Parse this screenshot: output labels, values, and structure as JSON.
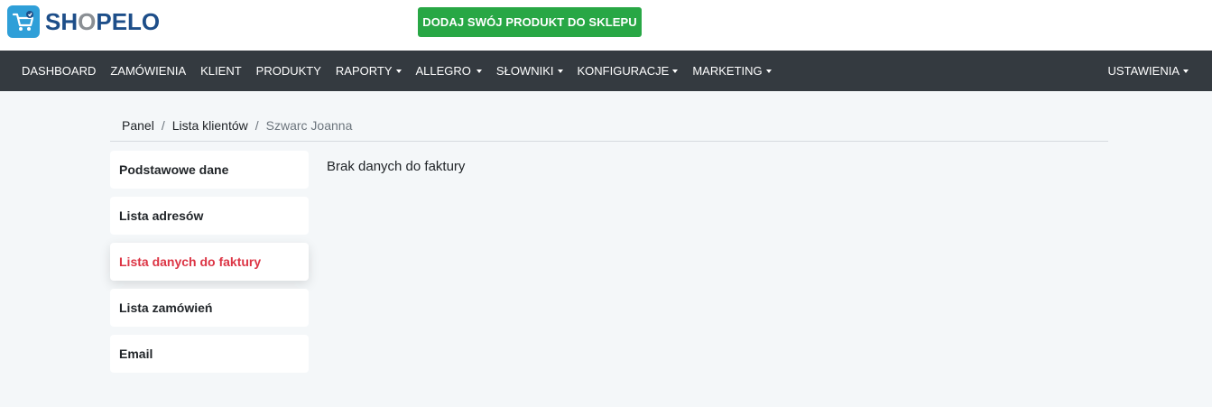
{
  "brand": {
    "logo_prefix": "SH",
    "logo_o": "O",
    "logo_suffix": "PELO",
    "primary_color": "#1d4e89",
    "accent_color": "#2f9fd8"
  },
  "header": {
    "cta_label": "DODAJ SWÓJ PRODUKT DO SKLEPU",
    "cta_color": "#28a745"
  },
  "nav": {
    "items": [
      {
        "label": "DASHBOARD",
        "dropdown": false
      },
      {
        "label": "ZAMÓWIENIA",
        "dropdown": false
      },
      {
        "label": "KLIENT",
        "dropdown": false
      },
      {
        "label": "PRODUKTY",
        "dropdown": false
      },
      {
        "label": "RAPORTY",
        "dropdown": true
      },
      {
        "label": "ALLEGRO",
        "dropdown": true
      },
      {
        "label": "SŁOWNIKI",
        "dropdown": true
      },
      {
        "label": "KONFIGURACJE",
        "dropdown": true
      },
      {
        "label": "MARKETING",
        "dropdown": true
      }
    ],
    "right_label": "USTAWIENIA"
  },
  "breadcrumb": {
    "items": [
      "Panel",
      "Lista klientów"
    ],
    "current": "Szwarc Joanna"
  },
  "sidemenu": {
    "items": [
      {
        "label": "Podstawowe dane",
        "active": false
      },
      {
        "label": "Lista adresów",
        "active": false
      },
      {
        "label": "Lista danych do faktury",
        "active": true
      },
      {
        "label": "Lista zamówień",
        "active": false
      },
      {
        "label": "Email",
        "active": false
      }
    ],
    "active_color": "#dc3545"
  },
  "content": {
    "message": "Brak danych do faktury"
  }
}
